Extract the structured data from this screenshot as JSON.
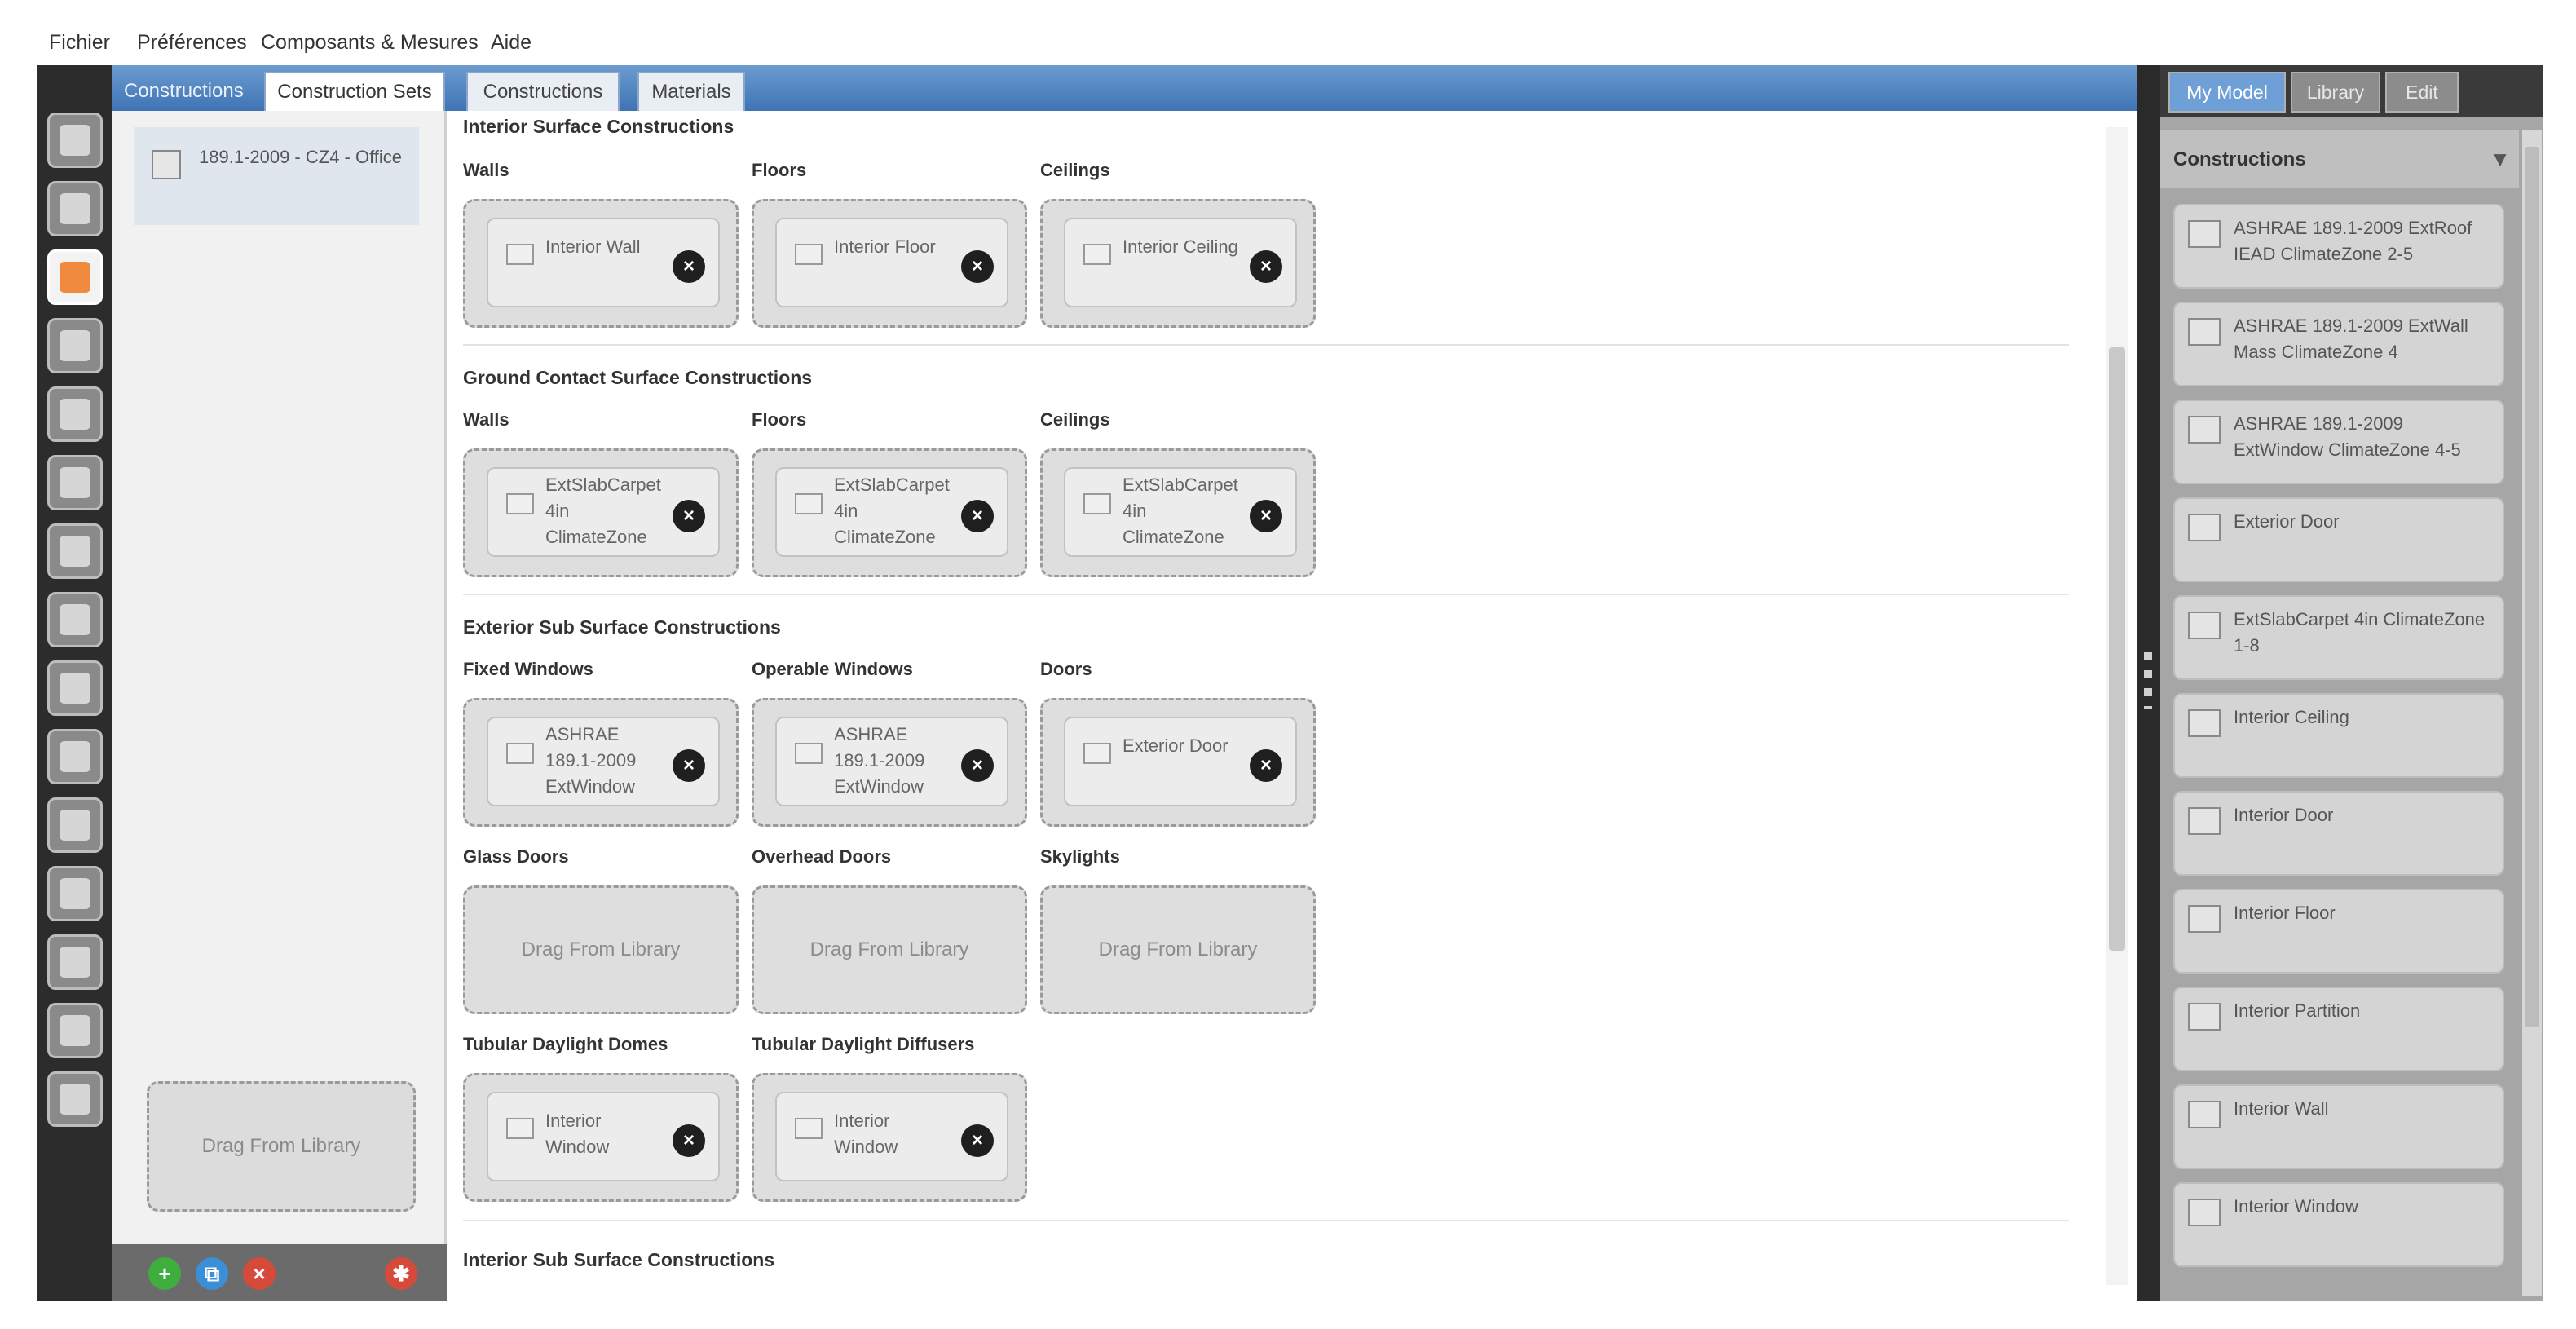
{
  "menu": [
    "Fichier",
    "Préférences",
    "Composants & Mesures",
    "Aide"
  ],
  "tabs": {
    "section": "Constructions",
    "construction_sets": "Construction Sets",
    "constructions": "Constructions",
    "materials": "Materials"
  },
  "list": {
    "item_label": "189.1-2009 - CZ4 - Office",
    "drop_label": "Drag From Library"
  },
  "content": {
    "sections": {
      "interior_surface": "Interior Surface Constructions",
      "ground_contact": "Ground Contact Surface Constructions",
      "exterior_sub": "Exterior Sub Surface Constructions",
      "interior_sub": "Interior Sub Surface Constructions"
    },
    "columns": {
      "walls": "Walls",
      "floors": "Floors",
      "ceilings": "Ceilings",
      "fixed_windows": "Fixed Windows",
      "operable_windows": "Operable Windows",
      "doors": "Doors",
      "glass_doors": "Glass Doors",
      "overhead_doors": "Overhead Doors",
      "skylights": "Skylights",
      "tubular_domes": "Tubular Daylight Domes",
      "tubular_diffusers": "Tubular Daylight Diffusers"
    },
    "cards": {
      "interior_wall": "Interior Wall",
      "interior_floor": "Interior Floor",
      "interior_ceiling": "Interior Ceiling",
      "ext_slab": "ExtSlabCarpet 4in ClimateZone",
      "ashrae_window": "ASHRAE 189.1-2009 ExtWindow",
      "exterior_door": "Exterior Door",
      "interior_window": "Interior Window"
    },
    "remove_symbol": "×",
    "drop_label": "Drag From Library"
  },
  "right": {
    "tabs": [
      "My Model",
      "Library",
      "Edit"
    ],
    "header": "Constructions",
    "chevron": "▼",
    "items": [
      "ASHRAE 189.1-2009 ExtRoof IEAD ClimateZone 2-5",
      "ASHRAE 189.1-2009 ExtWall Mass ClimateZone 4",
      "ASHRAE 189.1-2009 ExtWindow ClimateZone 4-5",
      "Exterior Door",
      "ExtSlabCarpet 4in ClimateZone 1-8",
      "Interior Ceiling",
      "Interior Door",
      "Interior Floor",
      "Interior Partition",
      "Interior Wall",
      "Interior Window"
    ]
  },
  "colors": {
    "accent": "#4a7fc1",
    "toolbar": "#2c2c2c",
    "active_tool": "#f08a3e"
  }
}
